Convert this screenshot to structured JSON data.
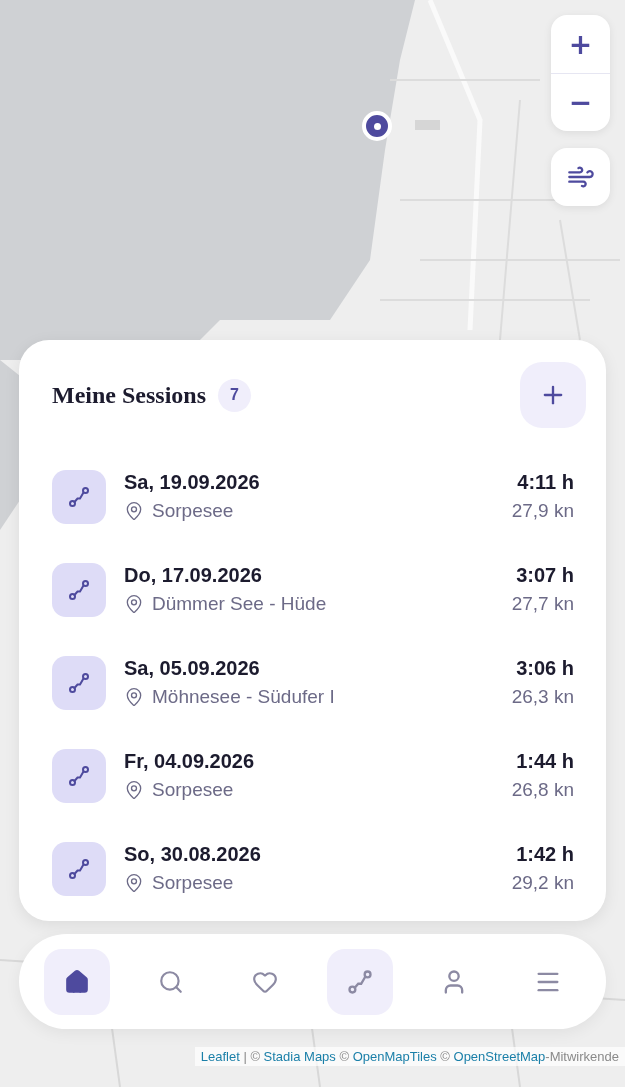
{
  "map_controls": {
    "zoom_in": "+",
    "zoom_out": "−"
  },
  "sessions": {
    "title": "Meine Sessions",
    "count": "7",
    "items": [
      {
        "date": "Sa, 19.09.2026",
        "place": "Sorpesee",
        "duration": "4:11 h",
        "speed": "27,9 kn"
      },
      {
        "date": "Do, 17.09.2026",
        "place": "Dümmer See - Hüde",
        "duration": "3:07 h",
        "speed": "27,7 kn"
      },
      {
        "date": "Sa, 05.09.2026",
        "place": "Möhnesee - Südufer I",
        "duration": "3:06 h",
        "speed": "26,3 kn"
      },
      {
        "date": "Fr, 04.09.2026",
        "place": "Sorpesee",
        "duration": "1:44 h",
        "speed": "26,8 kn"
      },
      {
        "date": "So, 30.08.2026",
        "place": "Sorpesee",
        "duration": "1:42 h",
        "speed": "29,2 kn"
      }
    ]
  },
  "nav": [
    {
      "kind": "home",
      "selected": true,
      "highlighted": false
    },
    {
      "kind": "search",
      "selected": false,
      "highlighted": false
    },
    {
      "kind": "favorites",
      "selected": false,
      "highlighted": false
    },
    {
      "kind": "sessions",
      "selected": false,
      "highlighted": true
    },
    {
      "kind": "profile",
      "selected": false,
      "highlighted": false
    },
    {
      "kind": "menu",
      "selected": false,
      "highlighted": false
    }
  ],
  "attribution": [
    {
      "text": "Leaflet",
      "link": true
    },
    {
      "text": " | © ",
      "link": false
    },
    {
      "text": "Stadia Maps",
      "link": true
    },
    {
      "text": " © ",
      "link": false
    },
    {
      "text": "OpenMapTiles",
      "link": true
    },
    {
      "text": " © ",
      "link": false
    },
    {
      "text": "OpenStreetMap",
      "link": true
    },
    {
      "text": "-Mitwirkende",
      "link": false
    }
  ]
}
